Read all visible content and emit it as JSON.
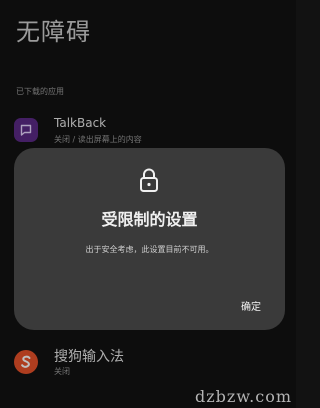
{
  "page": {
    "title": "无障碍"
  },
  "section": {
    "downloaded_header": "已下载的应用"
  },
  "apps": [
    {
      "name": "TalkBack",
      "subtitle": "关闭 / 读出屏幕上的内容",
      "icon": "speech-bubble-icon",
      "icon_color": "#5b2a86"
    },
    {
      "name": "搜狗输入法",
      "subtitle": "关闭",
      "icon": "sogou-s-icon",
      "icon_color": "#e8522a"
    }
  ],
  "dialog": {
    "icon": "lock-icon",
    "title": "受限制的设置",
    "message": "出于安全考虑，此设置目前不可用。",
    "confirm_label": "确定"
  },
  "watermark": {
    "text": "dzbzw.com"
  }
}
